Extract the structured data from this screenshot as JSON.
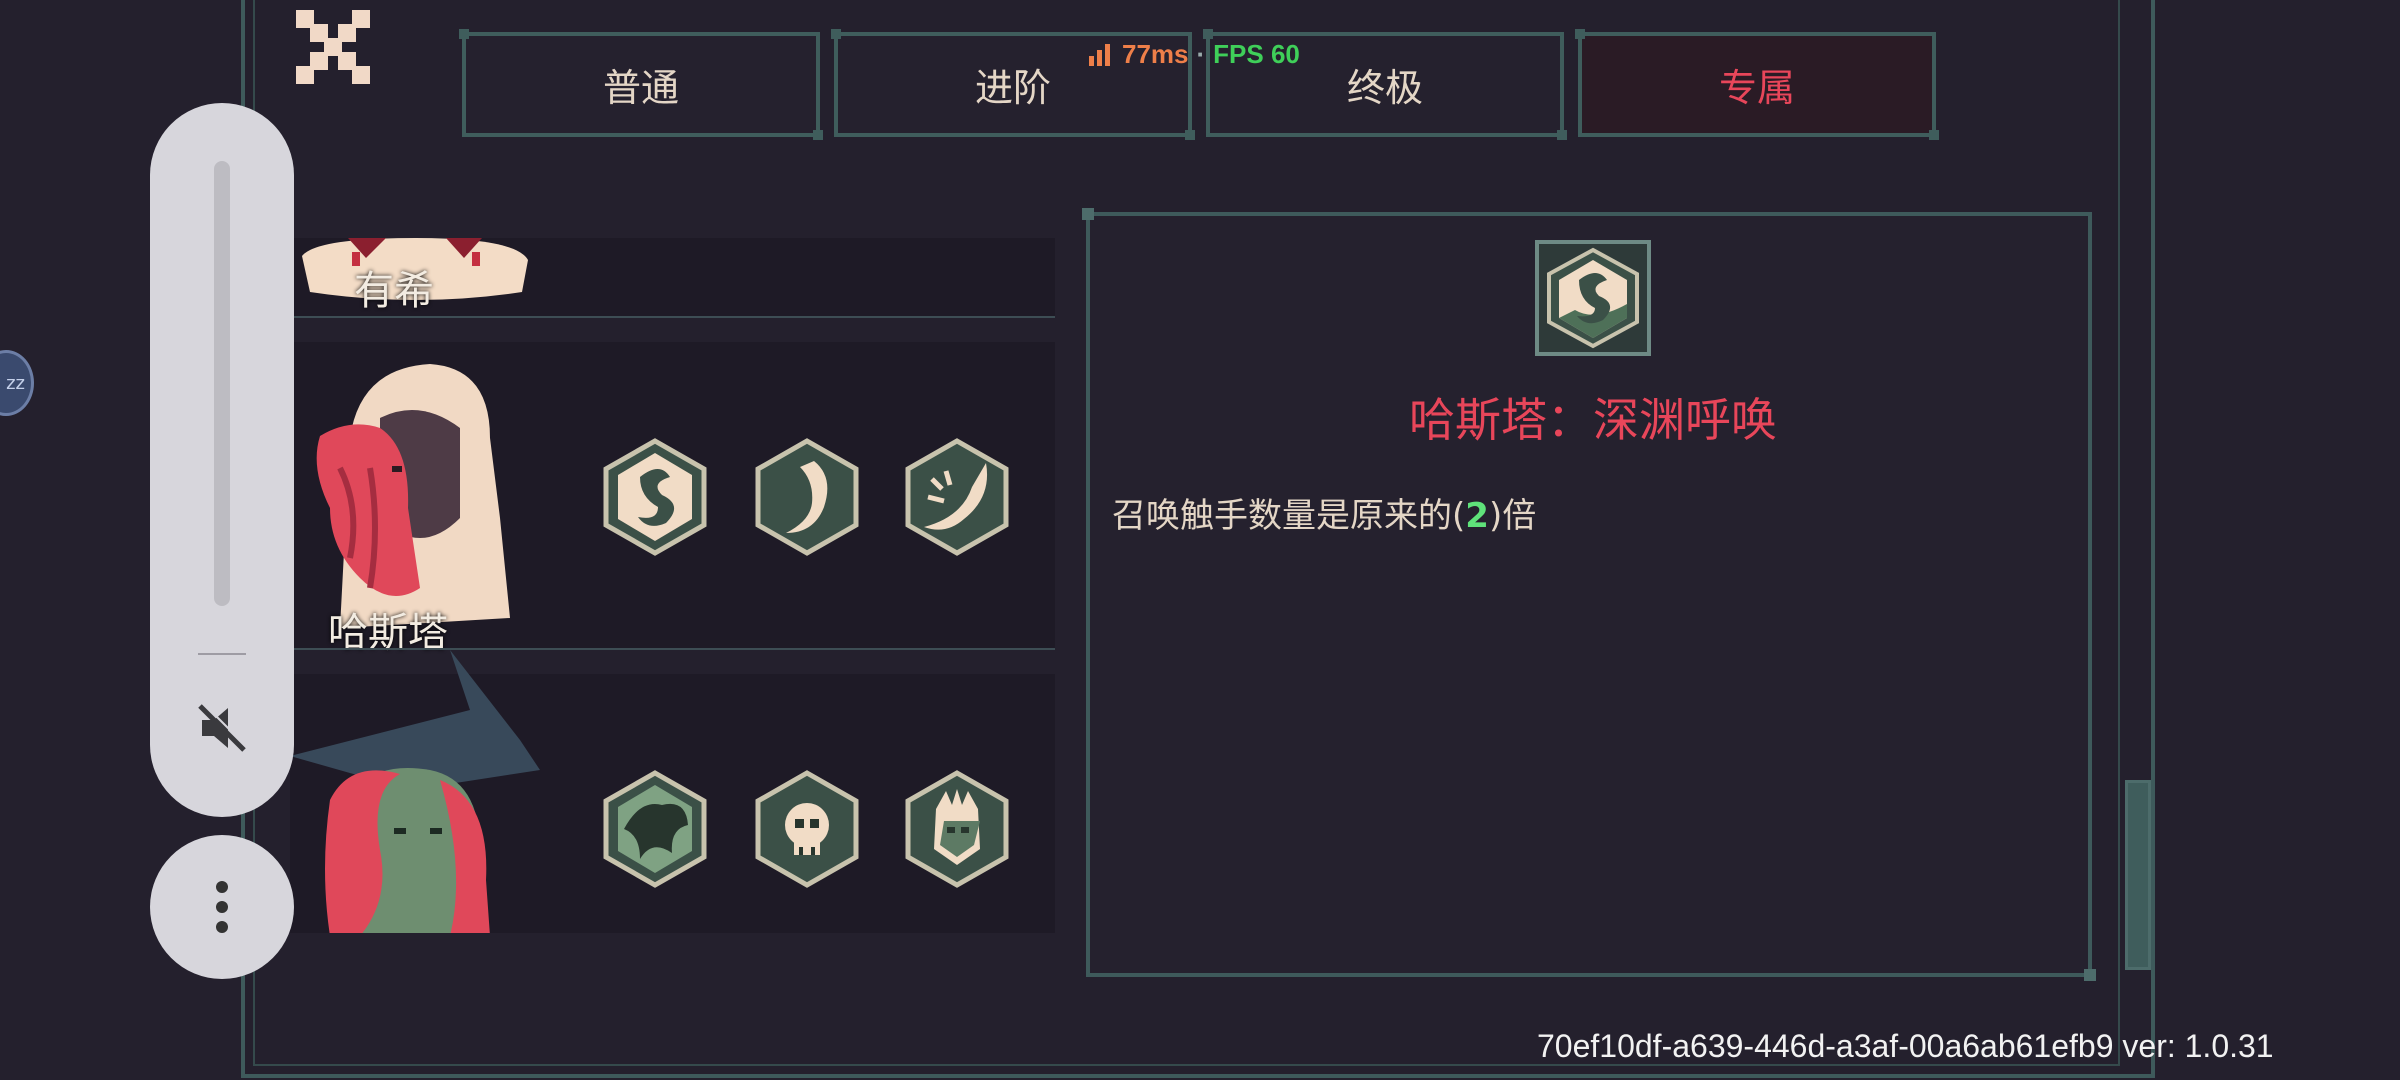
{
  "network": {
    "ping": "77ms",
    "separator": "·",
    "fps": "FPS 60"
  },
  "tabs": [
    {
      "label": "普通",
      "active": false
    },
    {
      "label": "进阶",
      "active": false
    },
    {
      "label": "终极",
      "active": false
    },
    {
      "label": "专属",
      "active": true
    }
  ],
  "characters": [
    {
      "name": "有希",
      "skills": []
    },
    {
      "name": "哈斯塔",
      "skills": [
        "abyss-call-icon",
        "tentacle-icon",
        "tentacle-storm-icon"
      ]
    },
    {
      "name": "",
      "skills": [
        "shadow-beast-icon",
        "skull-icon",
        "ghost-icon"
      ]
    }
  ],
  "detail": {
    "icon": "abyss-call-icon",
    "title": "哈斯塔：深渊呼唤",
    "desc_prefix": "召唤触手数量是原来的(",
    "desc_value": "2",
    "desc_suffix": ")倍"
  },
  "overlay": {
    "bubble_text": "zz"
  },
  "footer": {
    "build_info": "70ef10df-a639-446d-a3af-00a6ab61efb9 ver: 1.0.31"
  },
  "colors": {
    "background": "#24202d",
    "frame": "#3e5a5b",
    "accent_red": "#e8465a",
    "text_cream": "#e4d6c6",
    "value_green": "#5fe27a"
  }
}
